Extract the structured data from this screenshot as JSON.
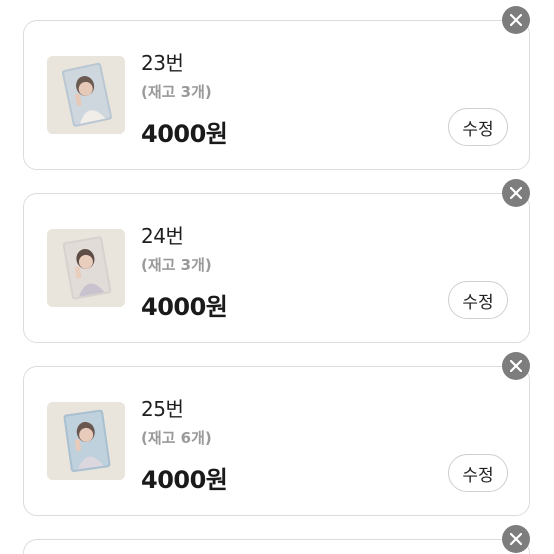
{
  "cart": {
    "items": [
      {
        "name": "23번",
        "stock": "(재고 3개)",
        "price": "4000원",
        "edit_label": "수정",
        "remove_icon": "close-icon",
        "photo": "photocard-thumbnail"
      },
      {
        "name": "24번",
        "stock": "(재고 3개)",
        "price": "4000원",
        "edit_label": "수정",
        "remove_icon": "close-icon",
        "photo": "photocard-thumbnail"
      },
      {
        "name": "25번",
        "stock": "(재고 6개)",
        "price": "4000원",
        "edit_label": "수정",
        "remove_icon": "close-icon",
        "photo": "photocard-thumbnail"
      }
    ]
  },
  "colors": {
    "close_bg": "#7d7d7d",
    "card_border": "#dcdcdc",
    "stock_text": "#9a9a9a"
  }
}
